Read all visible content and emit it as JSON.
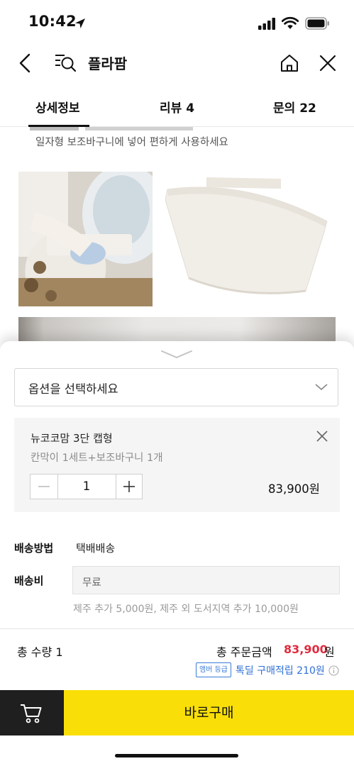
{
  "status_bar": {
    "time": "10:42"
  },
  "header": {
    "title": "플라팜"
  },
  "tabs": [
    {
      "label": "상세정보",
      "active": true
    },
    {
      "label": "리뷰 4",
      "active": false
    },
    {
      "label": "문의 22",
      "active": false
    }
  ],
  "detail": {
    "caption": "일자형 보조바구니에 넣어 편하게 사용하세요"
  },
  "option_select": {
    "placeholder": "옵션을 선택하세요"
  },
  "selected_option": {
    "name": "뉴코코맘 3단 캡형",
    "detail": "칸막이 1세트+보조바구니 1개",
    "quantity": "1",
    "price": "83,900원"
  },
  "shipping": {
    "method_label": "배송방법",
    "method_value": "택배배송",
    "fee_label": "배송비",
    "fee_value": "무료",
    "fee_note": "제주 추가 5,000원, 제주 외 도서지역 추가 10,000원"
  },
  "summary": {
    "total_qty": "총 수량 1",
    "total_label": "총 주문금액",
    "total_price": "83,900",
    "currency": "원",
    "grade_badge": "앰버 등급",
    "reward": "톡딜 구매적립 210원"
  },
  "buy_button": {
    "label": "바로구매"
  },
  "colors": {
    "buy_yellow": "#f9df07",
    "price_red": "#e02c3f",
    "reward_blue": "#2f6fd6"
  }
}
